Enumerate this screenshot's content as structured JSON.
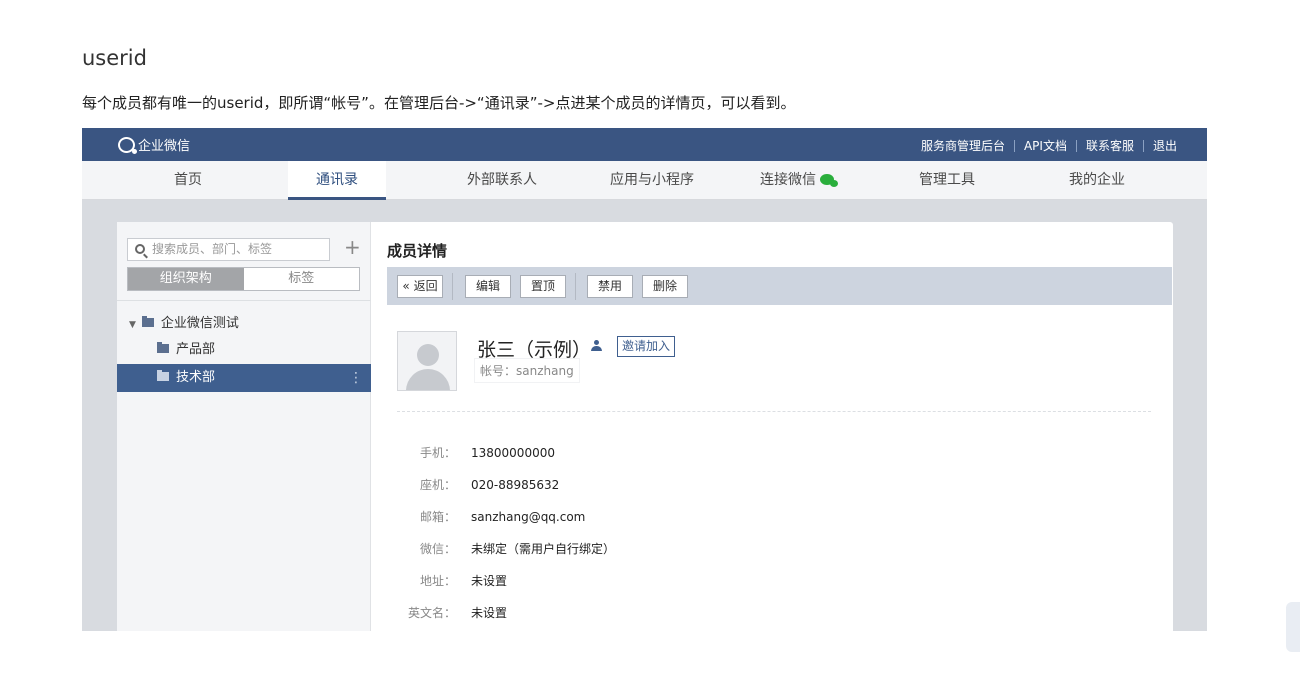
{
  "doc": {
    "title": "userid",
    "description": "每个成员都有唯一的userid，即所谓“帐号”。在管理后台->“通讯录”->点进某个成员的详情页，可以看到。"
  },
  "app": {
    "logo_text": "企业微信",
    "top_links": [
      "服务商管理后台",
      "API文档",
      "联系客服",
      "退出"
    ],
    "nav": [
      {
        "label": "首页",
        "active": false
      },
      {
        "label": "通讯录",
        "active": true
      },
      {
        "label": "外部联系人",
        "active": false
      },
      {
        "label": "应用与小程序",
        "active": false
      },
      {
        "label": "连接微信",
        "active": false
      },
      {
        "label": "管理工具",
        "active": false
      },
      {
        "label": "我的企业",
        "active": false
      }
    ],
    "accent_color": "#3a5582"
  },
  "sidebar": {
    "search_placeholder": "搜索成员、部门、标签",
    "tabs": [
      "组织架构",
      "标签"
    ],
    "tree": [
      {
        "label": "企业微信测试",
        "level": 0,
        "selected": false
      },
      {
        "label": "产品部",
        "level": 1,
        "selected": false
      },
      {
        "label": "技术部",
        "level": 1,
        "selected": true
      }
    ]
  },
  "detail": {
    "title": "成员详情",
    "buttons": [
      "« 返回",
      "编辑",
      "置顶",
      "禁用",
      "删除"
    ],
    "name": "张三（示例）",
    "invite_label": "邀请加入",
    "account": "帐号：sanzhang",
    "fields": [
      {
        "label": "手机：",
        "value": "13800000000"
      },
      {
        "label": "座机：",
        "value": "020-88985632"
      },
      {
        "label": "邮箱：",
        "value": "sanzhang@qq.com"
      },
      {
        "label": "微信：",
        "value": "未绑定（需用户自行绑定）"
      },
      {
        "label": "地址：",
        "value": "未设置"
      },
      {
        "label": "英文名：",
        "value": "未设置"
      }
    ]
  }
}
